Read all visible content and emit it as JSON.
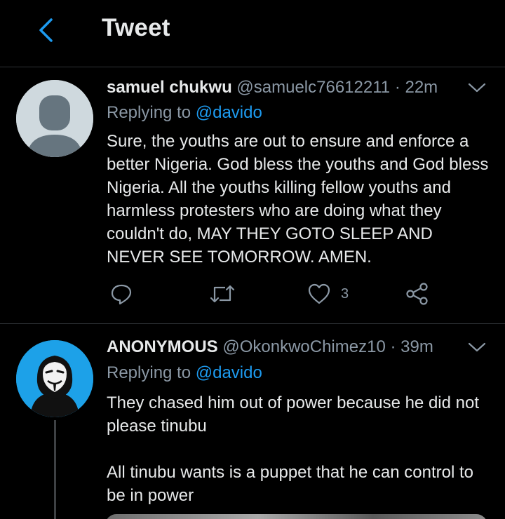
{
  "header": {
    "title": "Tweet"
  },
  "tweets": [
    {
      "name": "samuel chukwu",
      "handle": "@samuelc76612211",
      "separator": "·",
      "time": "22m",
      "replying_prefix": "Replying to",
      "replying_to": "@davido",
      "body": "Sure, the youths are out to ensure and enforce a better Nigeria. God bless the youths and God bless Nigeria. All the youths killing fellow youths and harmless protesters who are doing what they couldn't do, MAY THEY GOTO SLEEP AND NEVER SEE TOMORROW. AMEN.",
      "like_count": "3",
      "avatar": "default-avatar-icon"
    },
    {
      "name": "ANONYMOUS",
      "handle": "@OkonkwoChimez10",
      "separator": "·",
      "time": "39m",
      "replying_prefix": "Replying to",
      "replying_to": "@davido",
      "body": "They chased him out of power because he did not please tinubu\n\nAll tinubu wants is a puppet that he can control to be in power",
      "avatar": "anonymous-mask-icon"
    }
  ],
  "colors": {
    "background": "#000000",
    "accent": "#1d9bf0",
    "muted": "#8b98a5",
    "divider": "#2f3336"
  }
}
